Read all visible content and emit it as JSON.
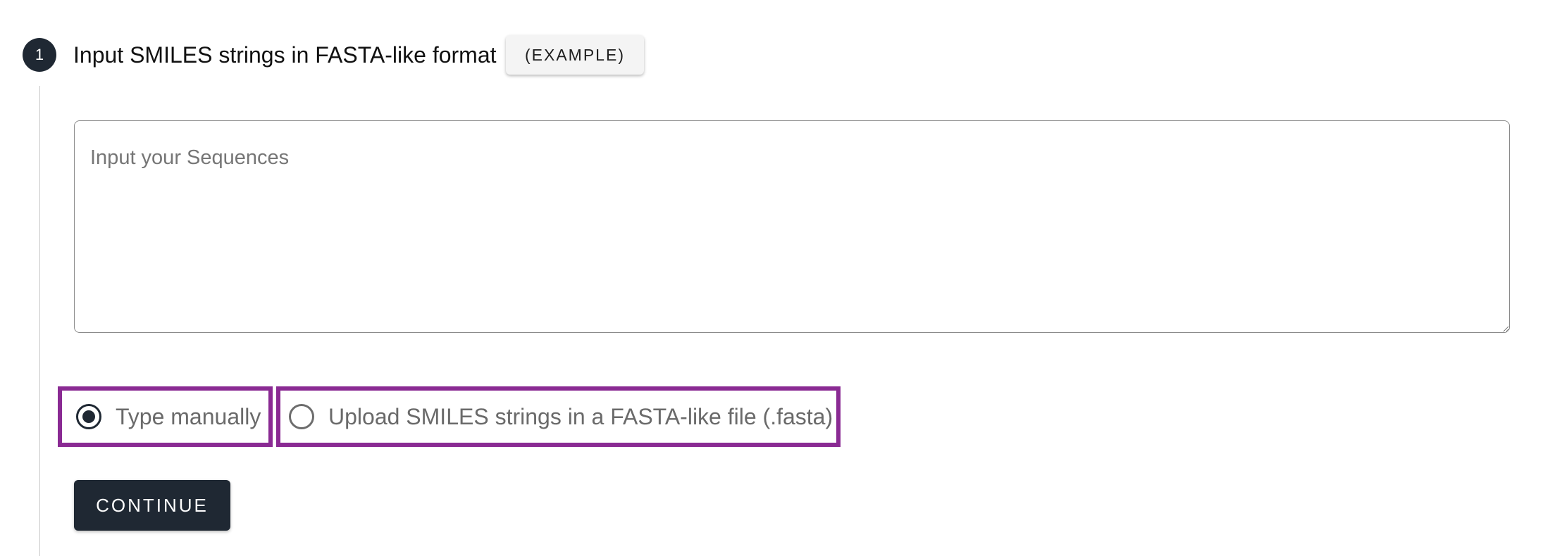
{
  "step": {
    "number": "1",
    "title": "Input SMILES strings in FASTA-like format",
    "example_label": "(EXAMPLE)"
  },
  "sequence_input": {
    "placeholder": "Input your Sequences",
    "value": ""
  },
  "input_mode": {
    "options": [
      {
        "label": "Type manually",
        "selected": true
      },
      {
        "label": "Upload SMILES strings in a FASTA-like file (.fasta)",
        "selected": false
      }
    ]
  },
  "continue_label": "CONTINUE",
  "colors": {
    "primary": "#1f2833",
    "highlight_border": "#8a2a93"
  }
}
